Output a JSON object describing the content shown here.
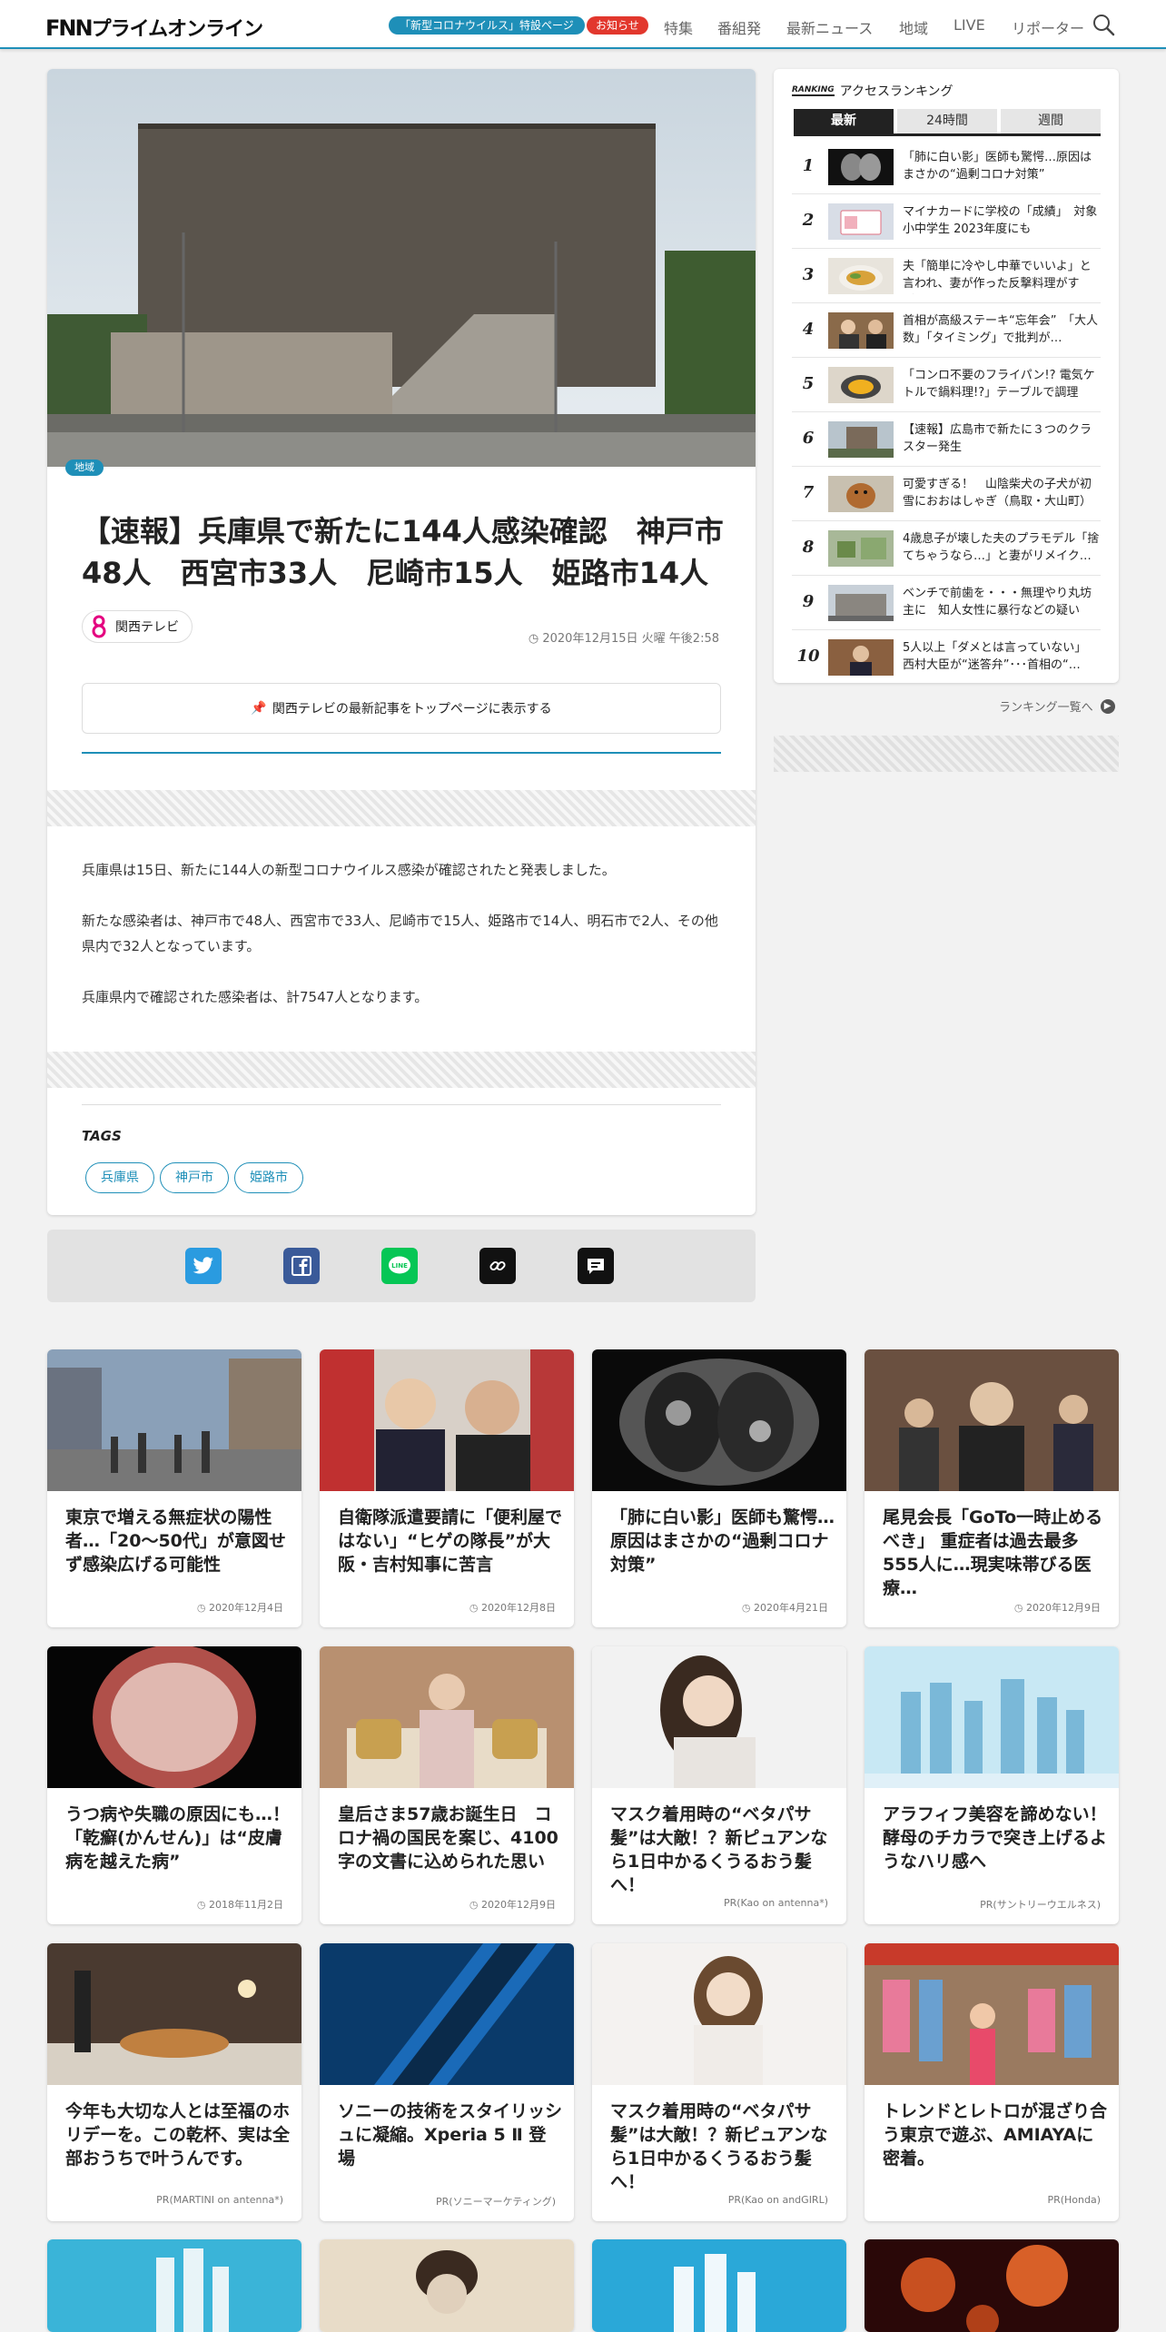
{
  "header": {
    "logo_fnn": "FNN",
    "logo_text": "プライムオンライン",
    "corona_pill": "「新型コロナウイルス」特設ページ",
    "notice_pill": "お知らせ",
    "nav": [
      "特集",
      "番組発",
      "最新ニュース",
      "地域",
      "LIVE",
      "リポーター"
    ]
  },
  "article": {
    "region_tag": "地域",
    "headline": "【速報】兵庫県で新たに144人感染確認　神戸市48人　西宮市33人　尼崎市15人　姫路市14人",
    "source": "関西テレビ",
    "date": "2020年12月15日 火曜 午後2:58",
    "pin_button": "関西テレビの最新記事をトップページに表示する",
    "paragraphs": [
      "兵庫県は15日、新たに144人の新型コロナウイルス感染が確認されたと発表しました。",
      "新たな感染者は、神戸市で48人、西宮市で33人、尼崎市で15人、姫路市で14人、明石市で2人、その他県内で32人となっています。",
      "兵庫県内で確認された感染者は、計7547人となります。"
    ],
    "tags_title": "TAGS",
    "tags": [
      "兵庫県",
      "神戸市",
      "姫路市"
    ]
  },
  "ranking": {
    "badge": "RANKING",
    "title": "アクセスランキング",
    "tabs": [
      "最新",
      "24時間",
      "週間"
    ],
    "items": [
      {
        "num": "1",
        "title": "「肺に白い影」医師も驚愕…原因はまさかの“過剰コロナ対策”"
      },
      {
        "num": "2",
        "title": "マイナカードに学校の「成績」　対象小中学生 2023年度にも"
      },
      {
        "num": "3",
        "title": "夫「簡単に冷やし中華でいいよ」と言われ、妻が作った反撃料理がすご…"
      },
      {
        "num": "4",
        "title": "首相が高級ステーキ“忘年会”　「大人数」「タイミング」で批判が…"
      },
      {
        "num": "5",
        "title": "「コンロ不要のフライパン!? 電気ケトルで鍋料理!?」テーブルで調理も…"
      },
      {
        "num": "6",
        "title": "【速報】広島市で新たに３つのクラスター発生"
      },
      {
        "num": "7",
        "title": "可愛すぎる！　山陰柴犬の子犬が初雪におおはしゃぎ（鳥取・大山町）"
      },
      {
        "num": "8",
        "title": "4歳息子が壊した夫のプラモデル「捨てちゃうなら…」と妻がリメイク…"
      },
      {
        "num": "9",
        "title": "ベンチで前歯を・・・無理やり丸坊主に　知人女性に暴行などの疑いで…"
      },
      {
        "num": "10",
        "title": "5人以上「ダメとは言っていない」 西村大臣が“迷答弁”･･･首相の“…"
      }
    ],
    "more": "ランキング一覧へ"
  },
  "cards": [
    {
      "title": "東京で増える無症状の陽性者…「20～50代」が意図せず感染広げる可能性",
      "meta": "2020年12月4日"
    },
    {
      "title": "自衛隊派遣要請に「便利屋ではない」“ヒゲの隊長”が大阪・吉村知事に苦言",
      "meta": "2020年12月8日"
    },
    {
      "title": "「肺に白い影」医師も驚愕…原因はまさかの“過剰コロナ対策”",
      "meta": "2020年4月21日"
    },
    {
      "title": "尾見会長「GoTo一時止めるべき」 重症者は過去最多555人に…現実味帯びる医療…",
      "meta": "2020年12月9日"
    },
    {
      "title": "うつ病や失職の原因にも…！「乾癬(かんせん)」は“皮膚病を越えた病”",
      "meta": "2018年11月2日"
    },
    {
      "title": "皇后さま57歳お誕生日　コロナ禍の国民を案じ、4100字の文書に込められた思い",
      "meta": "2020年12月9日"
    },
    {
      "title": "マスク着用時の“ベタパサ髪”は大敵！？新ピュアンなら1日中かるくうるおう髪へ！",
      "meta": "PR(Kao on antenna*)"
    },
    {
      "title": "アラフィフ美容を諦めない！酵母のチカラで突き上げるようなハリ感へ",
      "meta": "PR(サントリーウエルネス)"
    },
    {
      "title": "今年も大切な人とは至福のホリデーを。この乾杯、実は全部おうちで叶うんです。",
      "meta": "PR(MARTINI on antenna*)"
    },
    {
      "title": "ソニーの技術をスタイリッシュに凝縮。Xperia 5 Ⅱ 登場",
      "meta": "PR(ソニーマーケティング)"
    },
    {
      "title": "マスク着用時の“ベタパサ髪”は大敵！？新ピュアンなら1日中かるくうるおう髪へ！",
      "meta": "PR(Kao on andGIRL)"
    },
    {
      "title": "トレンドとレトロが混ざり合う東京で遊ぶ、AMIAYAに密着。",
      "meta": "PR(Honda)"
    }
  ],
  "colors": {
    "accent": "#1e8fb8",
    "notice": "#e2372d"
  }
}
